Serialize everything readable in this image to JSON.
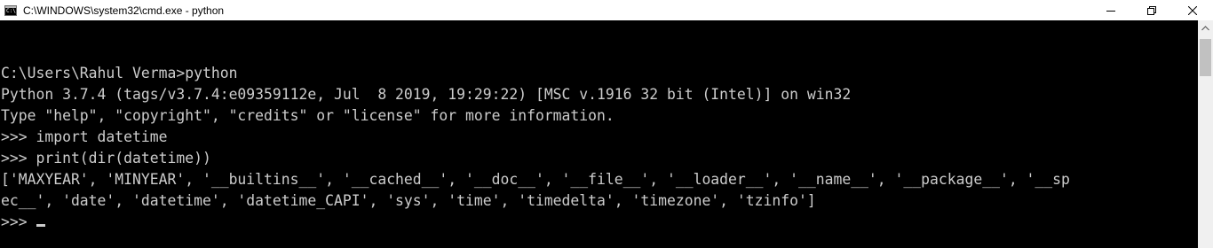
{
  "window": {
    "title": "C:\\WINDOWS\\system32\\cmd.exe - python",
    "icon": "cmd-icon",
    "controls": [
      "minimize-icon",
      "maximize-icon",
      "close-icon"
    ]
  },
  "console": {
    "lines": [
      "C:\\Users\\Rahul Verma>python",
      "Python 3.7.4 (tags/v3.7.4:e09359112e, Jul  8 2019, 19:29:22) [MSC v.1916 32 bit (Intel)] on win32",
      "Type \"help\", \"copyright\", \"credits\" or \"license\" for more information.",
      ">>> import datetime",
      ">>> print(dir(datetime))",
      "['MAXYEAR', 'MINYEAR', '__builtins__', '__cached__', '__doc__', '__file__', '__loader__', '__name__', '__package__', '__sp",
      "ec__', 'date', 'datetime', 'datetime_CAPI', 'sys', 'time', 'timedelta', 'timezone', 'tzinfo']"
    ],
    "prompt": ">>> "
  },
  "colors": {
    "background": "#000000",
    "text": "#cccccc",
    "titlebar": "#ffffff"
  }
}
